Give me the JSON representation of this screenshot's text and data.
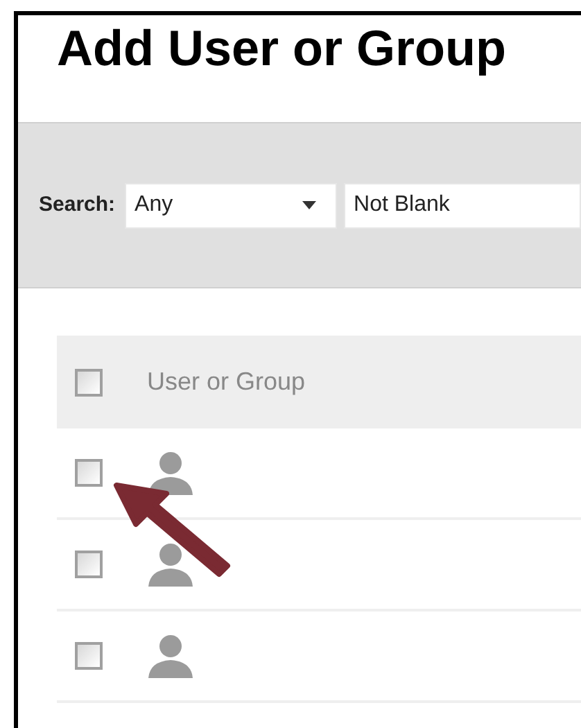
{
  "title": "Add User or Group",
  "search": {
    "label": "Search:",
    "scope": "Any",
    "condition": "Not Blank"
  },
  "table": {
    "header": {
      "label": "User or Group",
      "checked": false
    },
    "rows": [
      {
        "checked": false
      },
      {
        "checked": false
      },
      {
        "checked": false
      }
    ]
  }
}
